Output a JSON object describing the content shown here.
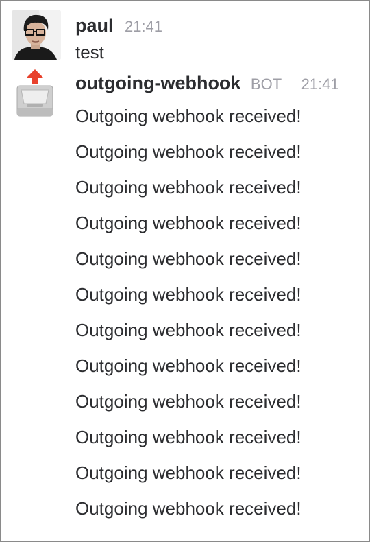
{
  "messages": {
    "paul": {
      "author": "paul",
      "time": "21:41",
      "text": "test"
    },
    "bot": {
      "author": "outgoing-webhook",
      "badge": "BOT",
      "time": "21:41",
      "lines": [
        "Outgoing webhook received!",
        "Outgoing webhook received!",
        "Outgoing webhook received!",
        "Outgoing webhook received!",
        "Outgoing webhook received!",
        "Outgoing webhook received!",
        "Outgoing webhook received!",
        "Outgoing webhook received!",
        "Outgoing webhook received!",
        "Outgoing webhook received!",
        "Outgoing webhook received!",
        "Outgoing webhook received!"
      ]
    }
  },
  "icons": {
    "paul_avatar": "user-avatar",
    "bot_avatar": "outbox-tray-icon"
  },
  "colors": {
    "text": "#2c2d30",
    "meta": "#9e9ea6",
    "arrow": "#e8412c"
  }
}
